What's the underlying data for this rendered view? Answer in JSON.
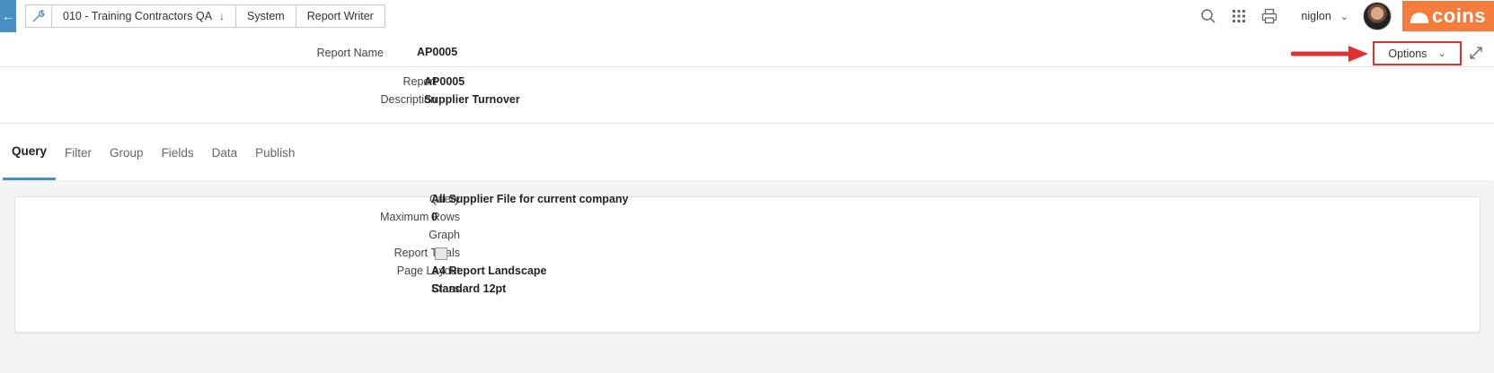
{
  "topbar": {
    "back_icon": "arrow-left-icon",
    "breadcrumbs": [
      {
        "label": "010 - Training Contractors QA"
      },
      {
        "label": "System"
      },
      {
        "label": "Report Writer"
      }
    ],
    "username": "niglon",
    "logo_text": "coins",
    "brand_color": "#f47c3c",
    "accent_color": "#4a8fc4"
  },
  "report_name": {
    "label": "Report Name",
    "value": "AP0005"
  },
  "options": {
    "label": "Options",
    "highlight_color": "#e03030"
  },
  "header": {
    "fields": [
      {
        "label": "Report",
        "value": "AP0005"
      },
      {
        "label": "Description",
        "value": "Supplier Turnover"
      }
    ]
  },
  "tabs": [
    {
      "label": "Query",
      "active": true
    },
    {
      "label": "Filter"
    },
    {
      "label": "Group"
    },
    {
      "label": "Fields"
    },
    {
      "label": "Data"
    },
    {
      "label": "Publish"
    }
  ],
  "query_panel": {
    "fields": [
      {
        "label": "Query",
        "value": "All Supplier File for current company"
      },
      {
        "label": "Maximum Rows",
        "value": "0"
      },
      {
        "label": "Graph",
        "value": ""
      },
      {
        "label": "Report Totals",
        "checked": false
      },
      {
        "label": "Page Layout",
        "value": "A4 Report Landscape"
      },
      {
        "label": "Class",
        "value": "Standard 12pt"
      }
    ]
  }
}
